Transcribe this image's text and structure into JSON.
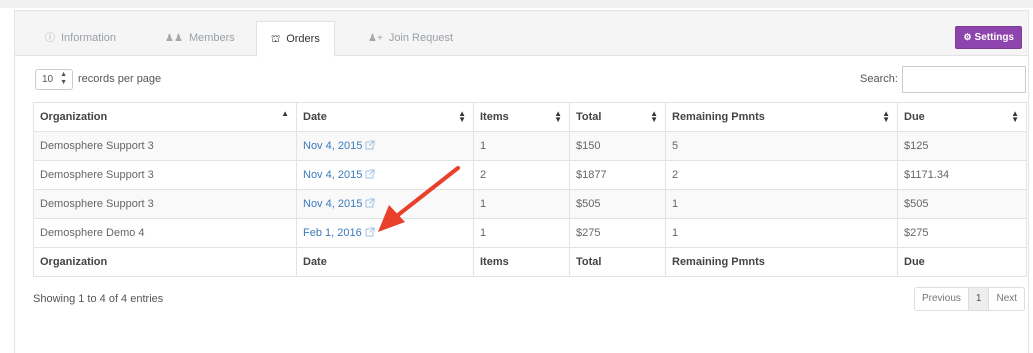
{
  "tabs": [
    {
      "label": "Information",
      "icon": "info-icon",
      "glyph": "❶"
    },
    {
      "label": "Members",
      "icon": "members-icon",
      "glyph": "👥"
    },
    {
      "label": "Orders",
      "icon": "cart-icon",
      "glyph": "🛒"
    },
    {
      "label": "Join Request",
      "icon": "user-plus-icon",
      "glyph": "👤"
    }
  ],
  "active_tab": "Orders",
  "settings_button": {
    "label": "Settings",
    "icon": "gear-icon"
  },
  "controls": {
    "records_per_page": "10",
    "records_label": "records per page",
    "search_label": "Search:",
    "search_value": ""
  },
  "table": {
    "headers": [
      "Organization",
      "Date",
      "Items",
      "Total",
      "Remaining Pmnts",
      "Due"
    ],
    "footers": [
      "Organization",
      "Date",
      "Items",
      "Total",
      "Remaining Pmnts",
      "Due"
    ],
    "rows": [
      {
        "organization": "Demosphere Support 3",
        "date": "Nov 4, 2015",
        "items": "1",
        "total": "$150",
        "remaining": "5",
        "due": "$125"
      },
      {
        "organization": "Demosphere Support 3",
        "date": "Nov 4, 2015",
        "items": "2",
        "total": "$1877",
        "remaining": "2",
        "due": "$1171.34"
      },
      {
        "organization": "Demosphere Support 3",
        "date": "Nov 4, 2015",
        "items": "1",
        "total": "$505",
        "remaining": "1",
        "due": "$505"
      },
      {
        "organization": "Demosphere Demo 4",
        "date": "Feb 1, 2016",
        "items": "1",
        "total": "$275",
        "remaining": "1",
        "due": "$275"
      }
    ]
  },
  "footer": {
    "info": "Showing 1 to 4 of 4 entries",
    "pagination": {
      "previous": "Previous",
      "current": "1",
      "next": "Next"
    }
  },
  "colors": {
    "accent": "#8e44ad",
    "link": "#3a7bbf",
    "annotation_arrow": "#e8402a"
  }
}
